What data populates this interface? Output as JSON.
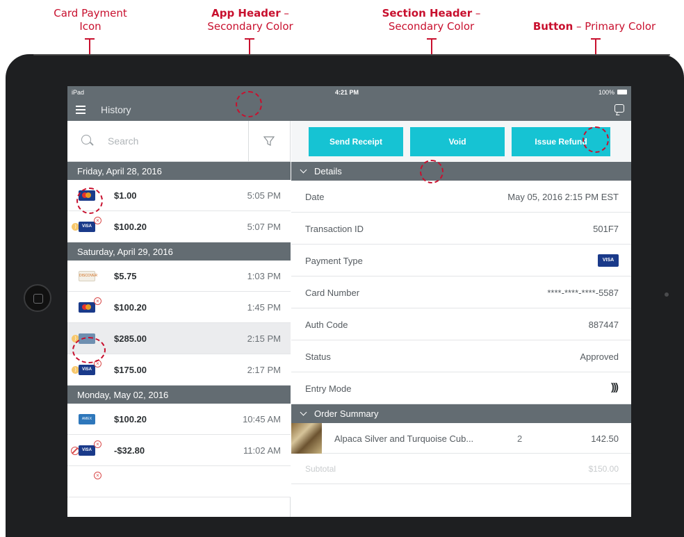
{
  "annotations": {
    "card_icon": {
      "line1": "Card Payment",
      "line2": "Icon"
    },
    "app_header": {
      "bold": "App Header",
      "dash": " –",
      "line2": "Secondary Color"
    },
    "section_header": {
      "bold": "Section Header",
      "dash": " –",
      "line2": "Secondary Color"
    },
    "button": {
      "bold": "Button",
      "rest": " – Primary Color"
    },
    "accent_color": "#c8102e"
  },
  "status_bar": {
    "carrier": "iPad",
    "time": "4:21 PM",
    "battery": "100%"
  },
  "app_header": {
    "title": "History",
    "color": "#636c72"
  },
  "search": {
    "placeholder": "Search"
  },
  "history_groups": [
    {
      "date": "Friday, April 28, 2016",
      "items": [
        {
          "card": "mastercard",
          "amount": "$1.00",
          "time": "5:05 PM"
        },
        {
          "card": "visa",
          "amount": "$100.20",
          "time": "5:07 PM"
        }
      ]
    },
    {
      "date": "Saturday, April 29, 2016",
      "items": [
        {
          "card": "discover",
          "card_text": "DISCOVER",
          "amount": "$5.75",
          "time": "1:03 PM"
        },
        {
          "card": "mastercard",
          "amount": "$100.20",
          "time": "1:45 PM"
        },
        {
          "card": "generic",
          "amount": "$285.00",
          "time": "2:15 PM",
          "selected": true
        },
        {
          "card": "visa",
          "amount": "$175.00",
          "time": "2:17 PM"
        }
      ]
    },
    {
      "date": "Monday, May 02, 2016",
      "items": [
        {
          "card": "amex",
          "amount": "$100.20",
          "time": "10:45 AM"
        },
        {
          "card": "visa",
          "amount": "-$32.80",
          "time": "11:02 AM"
        }
      ]
    }
  ],
  "card_labels": {
    "visa": "VISA",
    "discover": "DISCOVER",
    "amex": "AMEX"
  },
  "actions": {
    "send_receipt": "Send Receipt",
    "void": "Void",
    "issue_refund": "Issue Refund",
    "color": "#16c3d3"
  },
  "details": {
    "title": "Details",
    "rows": [
      {
        "label": "Date",
        "value": "May 05, 2016 2:15 PM EST"
      },
      {
        "label": "Transaction ID",
        "value": "501F7"
      },
      {
        "label": "Payment Type",
        "value": "VISA"
      },
      {
        "label": "Card Number",
        "value": "****-****-****-5587"
      },
      {
        "label": "Auth Code",
        "value": "887447"
      },
      {
        "label": "Status",
        "value": "Approved"
      },
      {
        "label": "Entry Mode",
        "value": "contactless-icon"
      }
    ]
  },
  "order_summary": {
    "title": "Order Summary",
    "item": {
      "name": "Alpaca Silver and Turquoise Cub...",
      "qty": "2",
      "price": "142.50"
    },
    "subtotal_label": "Subtotal",
    "subtotal_value": "$150.00"
  }
}
